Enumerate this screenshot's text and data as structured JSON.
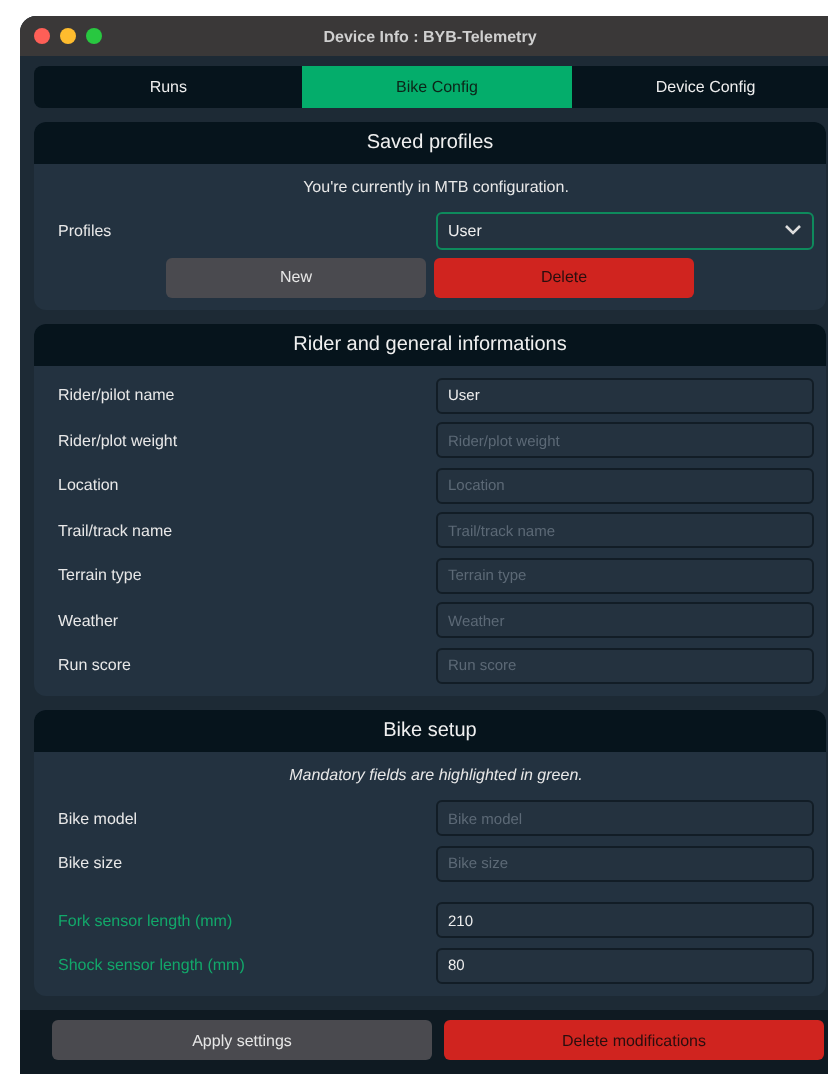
{
  "window": {
    "title": "Device Info : BYB-Telemetry"
  },
  "tabs": [
    {
      "label": "Runs",
      "selected": false
    },
    {
      "label": "Bike Config",
      "selected": true
    },
    {
      "label": "Device Config",
      "selected": false
    }
  ],
  "sections": [
    {
      "title": "Saved profiles",
      "note": "You're currently in MTB configuration.",
      "note_italic": false,
      "dropdown": {
        "label": "Profiles",
        "value": "User"
      },
      "buttons": [
        {
          "label": "New",
          "kind": "neutral"
        },
        {
          "label": "Delete",
          "kind": "danger"
        }
      ]
    },
    {
      "title": "Rider and general informations",
      "groups": [
        [
          {
            "label": "Rider/pilot name",
            "value": "User",
            "mandatory": false
          },
          {
            "label": "Rider/plot weight",
            "placeholder": "Rider/plot weight",
            "mandatory": false
          },
          {
            "label": "Location",
            "placeholder": "Location",
            "mandatory": false
          },
          {
            "label": "Trail/track name",
            "placeholder": "Trail/track name",
            "mandatory": false
          },
          {
            "label": "Terrain type",
            "placeholder": "Terrain type",
            "mandatory": false
          },
          {
            "label": "Weather",
            "placeholder": "Weather",
            "mandatory": false
          },
          {
            "label": "Run score",
            "placeholder": "Run score",
            "mandatory": false
          }
        ]
      ]
    },
    {
      "title": "Bike setup",
      "note": "Mandatory fields are highlighted in green.",
      "note_italic": true,
      "groups": [
        [
          {
            "label": "Bike model",
            "placeholder": "Bike model",
            "mandatory": false
          },
          {
            "label": "Bike size",
            "placeholder": "Bike size",
            "mandatory": false
          }
        ],
        [
          {
            "label": "Fork sensor length (mm)",
            "value": "210",
            "mandatory": true
          },
          {
            "label": "Shock sensor length (mm)",
            "value": "80",
            "mandatory": true
          }
        ]
      ]
    }
  ],
  "footer_buttons": [
    {
      "label": "Apply settings",
      "kind": "neutral"
    },
    {
      "label": "Delete modifications",
      "kind": "danger"
    }
  ]
}
